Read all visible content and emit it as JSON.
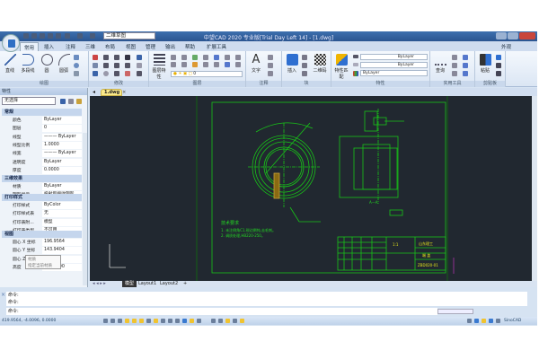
{
  "window": {
    "title": "中望CAD 2020 专业版[Trial Day Left 14] - [1.dwg]",
    "workspace": "二维草图",
    "appearance_menu": "外观"
  },
  "ribbon_tabs": [
    "常用",
    "插入",
    "注释",
    "三维",
    "布局",
    "视图",
    "管理",
    "输出",
    "帮助",
    "扩展工具"
  ],
  "panels": {
    "draw": "绘图",
    "modify": "修改",
    "layers": "图层",
    "annotate": "注释",
    "block": "块",
    "properties": "特性",
    "utilities": "实用工具",
    "clipboard": "剪贴板"
  },
  "buttons": {
    "line": "直线",
    "polyline": "多段线",
    "circle": "圆",
    "arc": "圆弧",
    "layer_props": "图层特性",
    "text": "文字",
    "insert": "插入",
    "qrcode": "二维码",
    "match_props": "特性匹配",
    "measure": "查询",
    "paste": "粘贴"
  },
  "layer_combo": "0",
  "prop_combos": {
    "color": "ByLayer",
    "linetype": "ByLayer",
    "lineweight": "ByLayer"
  },
  "properties_panel": {
    "title": "特性",
    "selection": "无选择",
    "sections": {
      "general": {
        "title": "常规",
        "rows": [
          [
            "颜色",
            "ByLayer"
          ],
          [
            "图层",
            "0"
          ],
          [
            "线型",
            "——— ByLayer"
          ],
          [
            "线型比例",
            "1.0000"
          ],
          [
            "线宽",
            "——— ByLayer"
          ],
          [
            "透明度",
            "ByLayer"
          ],
          [
            "厚度",
            "0.0000"
          ]
        ]
      },
      "three_d": {
        "title": "三维效果",
        "rows": [
          [
            "材质",
            "ByLayer"
          ],
          [
            "阴影显示",
            "投射和接收阴影"
          ]
        ]
      },
      "plot": {
        "title": "打印样式",
        "rows": [
          [
            "打印样式",
            "ByColor"
          ],
          [
            "打印样式表",
            "无"
          ],
          [
            "打印表附...",
            "模型"
          ],
          [
            "打印表类型",
            "不可用"
          ]
        ]
      },
      "view": {
        "title": "视图",
        "rows": [
          [
            "圆心 X 坐标",
            "196.9564"
          ],
          [
            "圆心 Y 坐标",
            "143.9404"
          ],
          [
            "圆心 Z 坐标",
            "0.0000"
          ],
          [
            "高度",
            "302.9400"
          ]
        ]
      }
    },
    "tooltip": {
      "title": "材质",
      "desc": "指定当前材质"
    }
  },
  "document_tab": "1.dwg",
  "drawing": {
    "tech_title": "技术要求",
    "tech_lines": [
      "1. 未注倒角C1,锐边倒钝,去毛刺。",
      "2. 调质处理,HB220-250。"
    ],
    "title_block": {
      "company": "山东理工",
      "part": "端 盖",
      "code": "ZBD020-01",
      "scale": "1:1"
    },
    "section_label": "A—A"
  },
  "layout_tabs": [
    "模型",
    "Layout1",
    "Layout2"
  ],
  "command_lines": [
    "命令:",
    "命令:",
    "命令:"
  ],
  "status": {
    "coords": "419.9564, -4.0096, 0.0000",
    "brand": "SinoCAD"
  }
}
